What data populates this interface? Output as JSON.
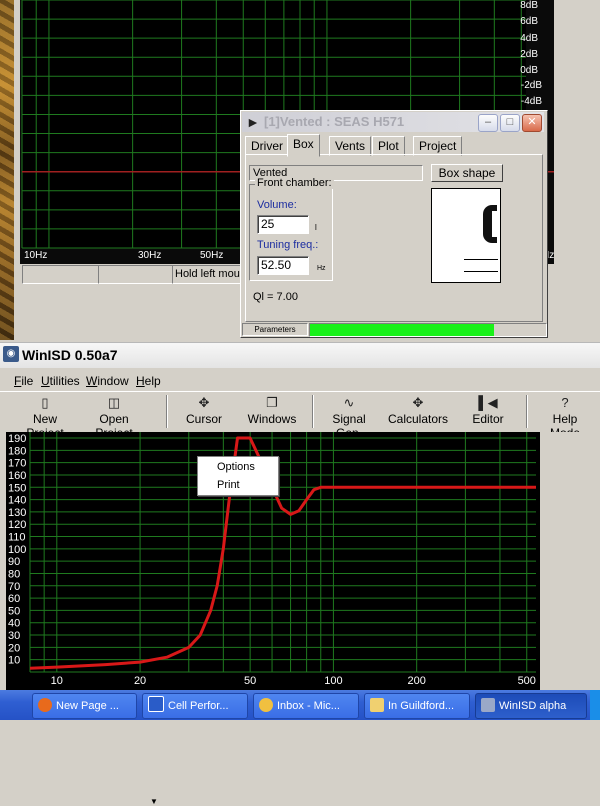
{
  "top_chart": {
    "y_labels": [
      "8dB",
      "6dB",
      "4dB",
      "2dB",
      "0dB",
      "-2dB",
      "-4dB"
    ],
    "x_labels": [
      "10Hz",
      "30Hz",
      "50Hz",
      "Hz"
    ],
    "status_hint": "Hold left mou"
  },
  "dialog": {
    "title": "[1]Vented : SEAS H571",
    "tabs": [
      "Driver",
      "Box",
      "Vents",
      "Plot",
      "Project"
    ],
    "box_type": "Vented",
    "box_shape_button": "Box shape",
    "group_label": "Front chamber:",
    "volume_label": "Volume:",
    "volume_value": "25",
    "volume_unit": "l",
    "tuning_label": "Tuning freq.:",
    "tuning_value": "52.50",
    "tuning_unit": "Hz",
    "ql_text": "Ql = 7.00",
    "parameters_label": "Parameters",
    "progress_fraction": 0.78
  },
  "app": {
    "title": "WinISD 0.50a7",
    "menus": [
      {
        "label": "File",
        "key": "F",
        "rest": "ile"
      },
      {
        "label": "Utilities",
        "key": "U",
        "rest": "tilities"
      },
      {
        "label": "Window",
        "key": "W",
        "rest": "indow"
      },
      {
        "label": "Help",
        "key": "H",
        "rest": "elp"
      }
    ],
    "toolbar": [
      {
        "label": "New Project",
        "icon": "new-project-icon"
      },
      {
        "label": "Open Project",
        "icon": "open-folder-icon"
      },
      {
        "label": "Cursor",
        "icon": "crosshair-icon"
      },
      {
        "label": "Windows",
        "icon": "windows-icon"
      },
      {
        "label": "Signal Gen.",
        "icon": "sine-wave-icon"
      },
      {
        "label": "Calculators",
        "icon": "calculator-icon"
      },
      {
        "label": "Editor",
        "icon": "editor-icon"
      },
      {
        "label": "Help Mode",
        "icon": "question-icon"
      }
    ],
    "context_menu": [
      "Options",
      "Print"
    ]
  },
  "taskbar": {
    "tasks": [
      {
        "label": "New Page ...",
        "icon_color": "#e86a1c"
      },
      {
        "label": "Cell Perfor...",
        "icon_color": "#2a5cc8"
      },
      {
        "label": "Inbox - Mic...",
        "icon_color": "#f0c040"
      },
      {
        "label": "In Guildford...",
        "icon_color": "#f0d070"
      },
      {
        "label": "WinISD alpha",
        "icon_color": "#9aa8c8"
      }
    ]
  },
  "chart_data": [
    {
      "type": "line",
      "title": "",
      "xlabel": "",
      "ylabel": "",
      "x_scale": "log",
      "xlim": [
        8,
        520
      ],
      "ylim": [
        -4,
        9
      ],
      "y_ticks": [
        "8dB",
        "6dB",
        "4dB",
        "2dB",
        "0dB",
        "-2dB",
        "-4dB"
      ],
      "x_ticks": [
        "10Hz",
        "30Hz",
        "50Hz"
      ],
      "reference_line_y": 0,
      "grid": true,
      "series": [
        {
          "color": "#34e81c",
          "x": [
            30,
            40,
            50,
            55,
            62,
            75,
            100,
            150,
            250,
            400,
            520
          ],
          "y": [
            -28,
            -14,
            -6,
            -3.5,
            -1.8,
            -0.7,
            -0.3,
            -0.12,
            -0.05,
            0,
            0
          ]
        }
      ]
    },
    {
      "type": "line",
      "title": "",
      "xlabel": "",
      "ylabel": "",
      "x_scale": "log",
      "xlim": [
        8,
        540
      ],
      "ylim": [
        0,
        190
      ],
      "y_ticks": [
        10,
        20,
        30,
        40,
        50,
        60,
        70,
        80,
        90,
        100,
        110,
        120,
        130,
        140,
        150,
        160,
        170,
        180,
        190
      ],
      "x_ticks": [
        10,
        20,
        50,
        100,
        200,
        500
      ],
      "grid": true,
      "series": [
        {
          "color": "#d81818",
          "x": [
            8,
            10,
            15,
            20,
            25,
            30,
            33,
            36,
            38,
            40,
            42,
            45,
            50,
            55,
            60,
            65,
            70,
            75,
            80,
            85,
            90,
            100,
            200,
            540
          ],
          "y": [
            3,
            4,
            6,
            8,
            12,
            20,
            30,
            50,
            70,
            100,
            140,
            190,
            190,
            170,
            150,
            133,
            128,
            131,
            140,
            148,
            150,
            150,
            150,
            150
          ]
        }
      ]
    }
  ]
}
